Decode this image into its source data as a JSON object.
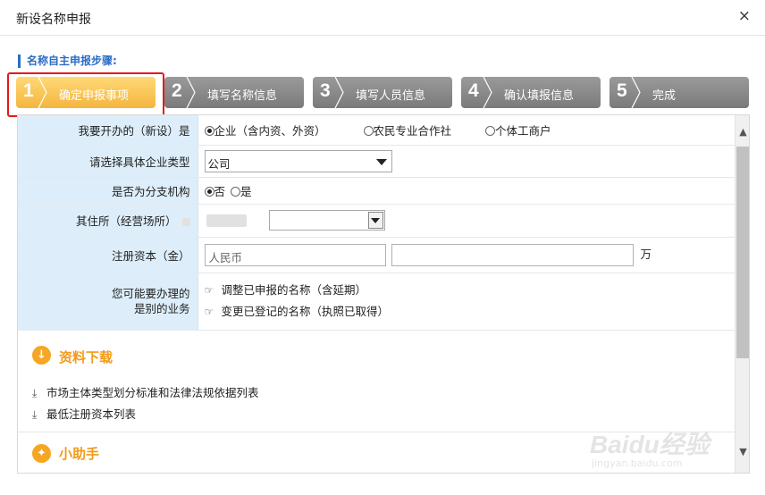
{
  "dialog": {
    "title": "新设名称申报",
    "close_glyph": "×"
  },
  "steps_heading": "名称自主申报步骤:",
  "steps": [
    {
      "num": "1",
      "label": "确定申报事项",
      "active": true
    },
    {
      "num": "2",
      "label": "填写名称信息",
      "active": false
    },
    {
      "num": "3",
      "label": "填写人员信息",
      "active": false
    },
    {
      "num": "4",
      "label": "确认填报信息",
      "active": false
    },
    {
      "num": "5",
      "label": "完成",
      "active": false
    }
  ],
  "form": {
    "type_label": "我要开办的（新设）是",
    "type_options": [
      {
        "label": "企业（含内资、外资）",
        "selected": true
      },
      {
        "label": "农民专业合作社",
        "selected": false
      },
      {
        "label": "个体工商户",
        "selected": false
      }
    ],
    "enterprise_type_label": "请选择具体企业类型",
    "enterprise_type_value": "公司",
    "branch_label": "是否为分支机构",
    "branch_options": [
      {
        "label": "否",
        "selected": true
      },
      {
        "label": "是",
        "selected": false
      }
    ],
    "residence_label": "其住所（经营场所）",
    "capital_label": "注册资本（金）",
    "capital_currency_placeholder": "人民币",
    "capital_unit": "万",
    "other_business_label_line1": "您可能要办理的",
    "other_business_label_line2": "是别的业务",
    "other_business_links": [
      "调整已申报的名称（含延期）",
      "变更已登记的名称（执照已取得）"
    ]
  },
  "downloads": {
    "title": "资料下载",
    "links": [
      "市场主体类型划分标准和法律法规依据列表",
      "最低注册资本列表"
    ]
  },
  "helper": {
    "title": "小助手"
  },
  "watermark": {
    "brand": "Baidu经验",
    "sub": "jingyan.baidu.com"
  },
  "colors": {
    "accent_blue": "#2b6cc4",
    "active_step": "#f4b63f",
    "inactive_step": "#8a8a8a",
    "highlight_red": "#e41a1a",
    "section_orange": "#f29a1a",
    "label_bg": "#ddeefa"
  }
}
